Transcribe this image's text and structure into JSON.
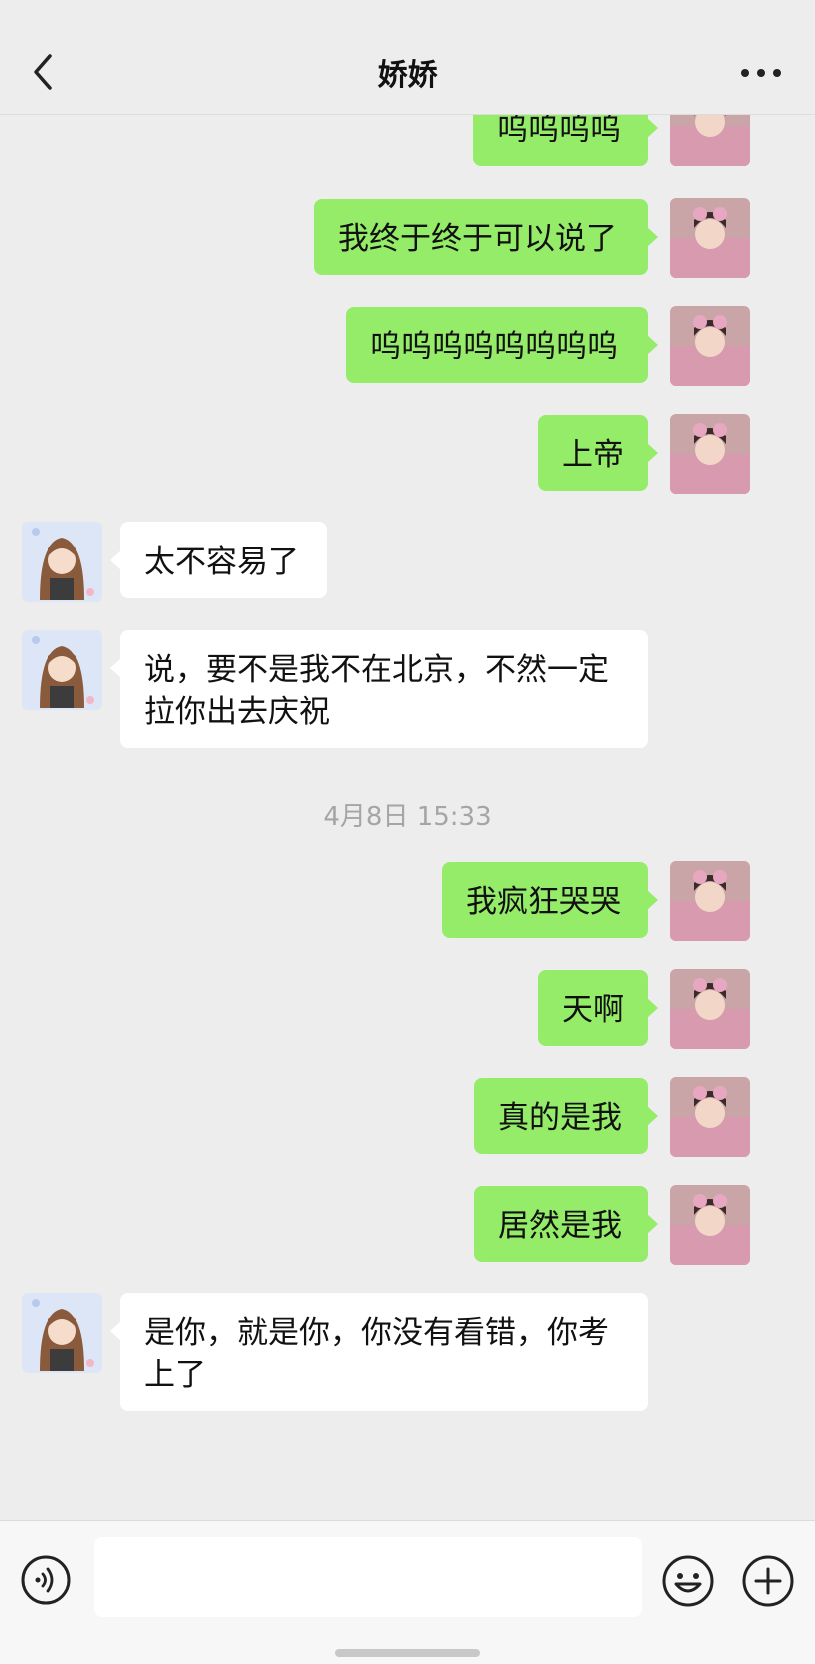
{
  "header": {
    "title": "娇娇"
  },
  "colors": {
    "self_bubble": "#95ec69",
    "other_bubble": "#ffffff",
    "background": "#ededed"
  },
  "icons": {
    "back": "chevron-left-icon",
    "more": "more-dots-icon",
    "voice": "voice-icon",
    "emoji": "emoji-icon",
    "plus": "plus-icon"
  },
  "messages": [
    {
      "side": "right",
      "text": "呜呜呜呜"
    },
    {
      "side": "right",
      "text": "我终于终于可以说了"
    },
    {
      "side": "right",
      "text": "呜呜呜呜呜呜呜呜"
    },
    {
      "side": "right",
      "text": "上帝"
    },
    {
      "side": "left",
      "text": "太不容易了"
    },
    {
      "side": "left",
      "text": "说，要不是我不在北京，不然一定\n拉你出去庆祝"
    },
    {
      "side": "right",
      "text": "我疯狂哭哭"
    },
    {
      "side": "right",
      "text": "天啊"
    },
    {
      "side": "right",
      "text": "真的是我"
    },
    {
      "side": "right",
      "text": "居然是我"
    },
    {
      "side": "left",
      "text": "是你，就是你，你没有看错，你考\n上了"
    }
  ],
  "timestamp": "4月8日 15:33",
  "composer": {
    "value": "",
    "placeholder": ""
  }
}
